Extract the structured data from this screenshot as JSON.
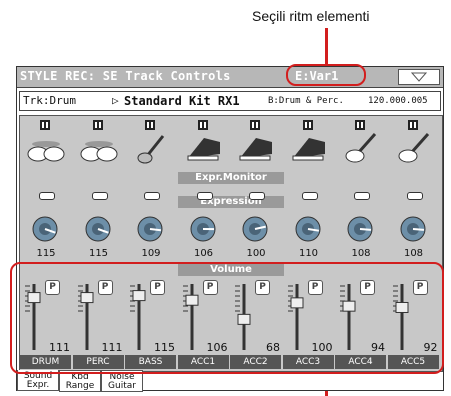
{
  "annotation": {
    "text": "Seçili ritm elementi"
  },
  "screen": {
    "title": "STYLE REC: SE Track Controls",
    "element": "E:Var1",
    "menu_icon": "triangle-down-icon",
    "track": {
      "name": "Trk:Drum",
      "kit": "Standard Kit RX1",
      "category": "B:Drum & Perc.",
      "program": "120.000.005"
    },
    "expr_monitor_label": "Expr.Monitor",
    "expression_label": "Expression",
    "volume_label": "Volume",
    "tracks": [
      {
        "label": "DRUM",
        "icon": "drum-kit-icon",
        "expression": "115",
        "volume": "111",
        "vol_frac": 0.87
      },
      {
        "label": "PERC",
        "icon": "drum-kit-icon",
        "expression": "115",
        "volume": "111",
        "vol_frac": 0.87
      },
      {
        "label": "BASS",
        "icon": "bass-guitar-icon",
        "expression": "109",
        "volume": "115",
        "vol_frac": 0.9
      },
      {
        "label": "ACC1",
        "icon": "piano-icon",
        "expression": "106",
        "volume": "106",
        "vol_frac": 0.83
      },
      {
        "label": "ACC2",
        "icon": "piano-icon",
        "expression": "100",
        "volume": "68",
        "vol_frac": 0.54
      },
      {
        "label": "ACC3",
        "icon": "piano-icon",
        "expression": "110",
        "volume": "100",
        "vol_frac": 0.79
      },
      {
        "label": "ACC4",
        "icon": "acoustic-guitar-icon",
        "expression": "108",
        "volume": "94",
        "vol_frac": 0.74
      },
      {
        "label": "ACC5",
        "icon": "acoustic-guitar-icon",
        "expression": "108",
        "volume": "92",
        "vol_frac": 0.72
      }
    ],
    "tabs": [
      {
        "line1": "Sound",
        "line2": "Expr."
      },
      {
        "line1": "Kbd",
        "line2": "Range"
      },
      {
        "line1": "Noise",
        "line2": "Guitar"
      }
    ]
  },
  "colors": {
    "highlight": "#d21e1e",
    "panel": "#c8c8c8",
    "banner": "#9a9a9a"
  }
}
